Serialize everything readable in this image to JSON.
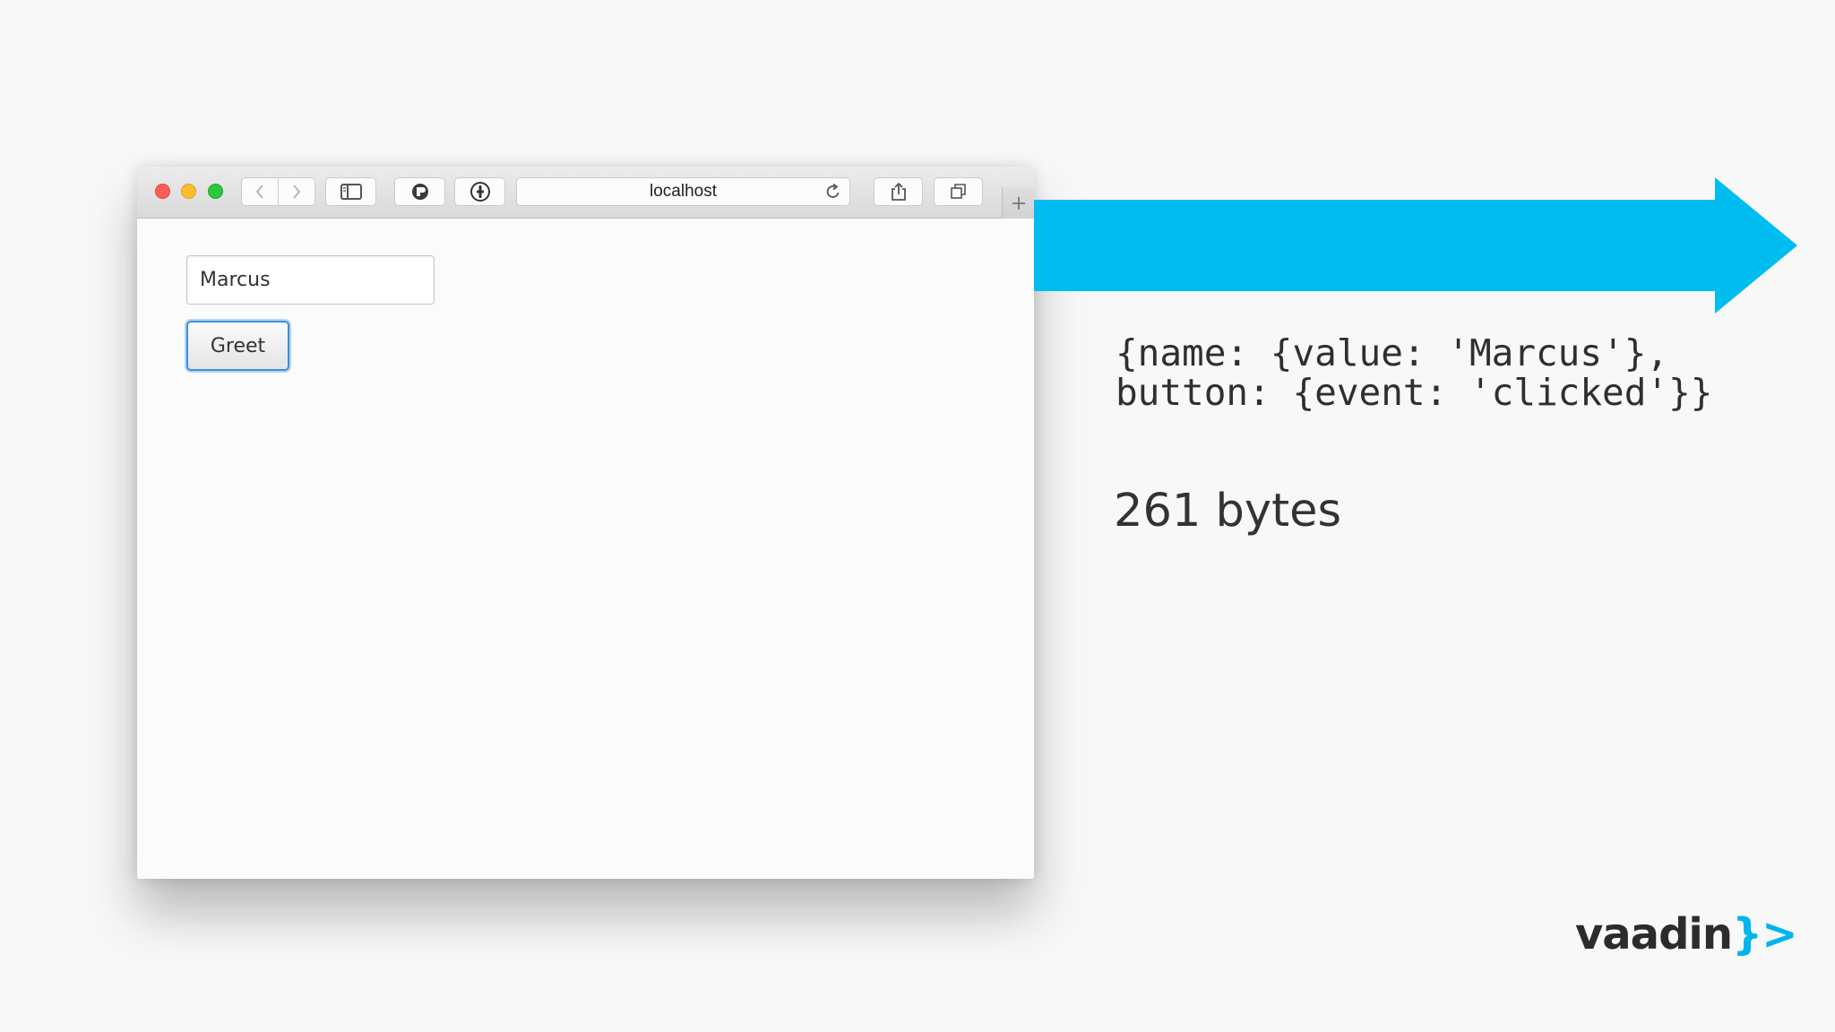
{
  "browser": {
    "url": "localhost",
    "buttons": [
      "back-icon",
      "forward-icon",
      "sidebar-icon",
      "extension-icon",
      "password-icon",
      "reload-icon",
      "share-icon",
      "tabs-icon",
      "new-tab-icon"
    ],
    "traffic_lights": {
      "close": "#fc5f57",
      "minimize": "#fdbc2e",
      "zoom": "#29c840"
    }
  },
  "app": {
    "name_field_value": "Marcus",
    "greet_label": "Greet"
  },
  "slide": {
    "payload_line1": "{name: {value: 'Marcus'},",
    "payload_line2": "button: {event: 'clicked'}}",
    "size_label": "261 bytes",
    "arrow_color": "#00bdf0",
    "logo_word": "vaadin",
    "logo_mark": "}>"
  }
}
